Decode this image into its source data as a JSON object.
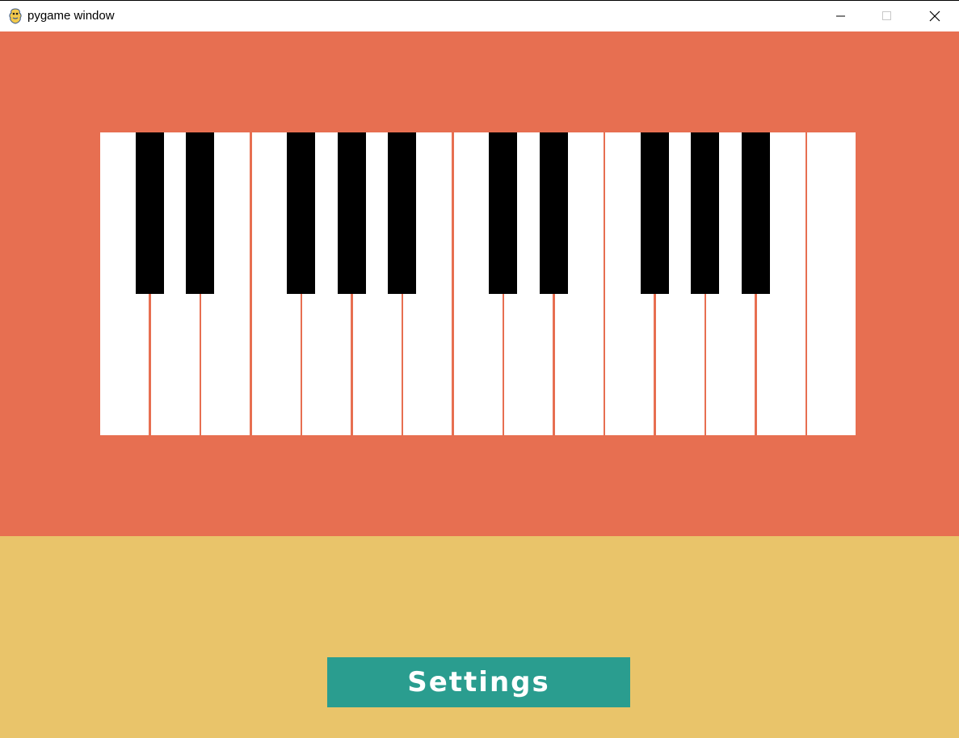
{
  "window": {
    "title": "pygame window",
    "icon": "pygame-snake-icon",
    "controls": [
      "minimize-icon",
      "maximize-icon",
      "close-icon"
    ]
  },
  "colors": {
    "piano_background": "#e76f51",
    "bottom_background": "#e9c46a",
    "button_background": "#2a9d8f",
    "white_key": "#ffffff",
    "black_key": "#000000"
  },
  "piano": {
    "white_key_count": 15,
    "black_key_count": 10
  },
  "settings_button": {
    "label": "Settings"
  }
}
